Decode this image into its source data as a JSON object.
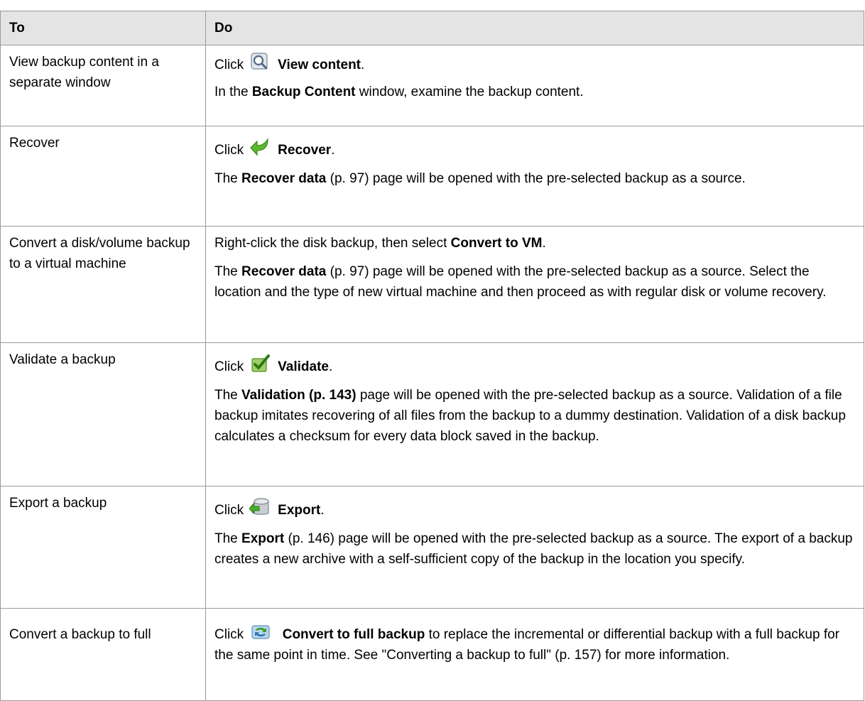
{
  "table": {
    "header": {
      "to": "To",
      "do": "Do"
    },
    "rows": [
      {
        "to": "View backup content in a separate window",
        "click": "Click",
        "action": "View content",
        "period": ".",
        "desc_a": "In the ",
        "desc_b": "Backup Content",
        "desc_c": " window, examine the backup content."
      },
      {
        "to": "Recover",
        "click": "Click",
        "action": "Recover",
        "period": ".",
        "desc_b": "Recover data",
        "desc_c": " (p. 97) page will be opened with the pre-selected backup as a source."
      },
      {
        "to": "Convert a disk/volume backup to a virtual machine",
        "line_a": "Right-click the disk backup, then select ",
        "line_b": "Convert to VM",
        "period": ".",
        "desc_b": "Recover data",
        "desc_c": " (p. 97) page will be opened with the pre-selected backup as a source. Select the location and the type of new virtual machine and then proceed as with regular disk or volume recovery."
      },
      {
        "to": "Validate a backup",
        "click": "Click",
        "action": "Validate",
        "period": ".",
        "desc_b": "Validation (p. 143)",
        "desc_c": " page will be opened with the pre-selected backup as a source. Validation of a file backup imitates recovering of all files from the backup to a dummy destination. Validation of a disk backup calculates a checksum for every data block saved in the backup."
      },
      {
        "to": "Export a backup",
        "click": "Click",
        "action": "Export",
        "period": ".",
        "desc_b": "Export",
        "desc_c": " (p. 146) page will be opened with the pre-selected backup as a source. The export of a backup creates a new archive with a self-sufficient copy of the backup in the location you specify."
      },
      {
        "to": "Convert a backup to full",
        "click": "Click",
        "action": "Convert to full backup",
        "desc_c": " to replace the incremental or differential backup with a full backup for the same point in time. See \"Converting a backup to full\" (p. 157) for more information."
      }
    ],
    "the_word": "The "
  },
  "icons": {
    "view_content": "magnifier-icon",
    "recover": "green-arrow-icon",
    "validate": "green-check-icon",
    "export": "database-export-icon",
    "convert_full": "convert-arrows-icon"
  }
}
